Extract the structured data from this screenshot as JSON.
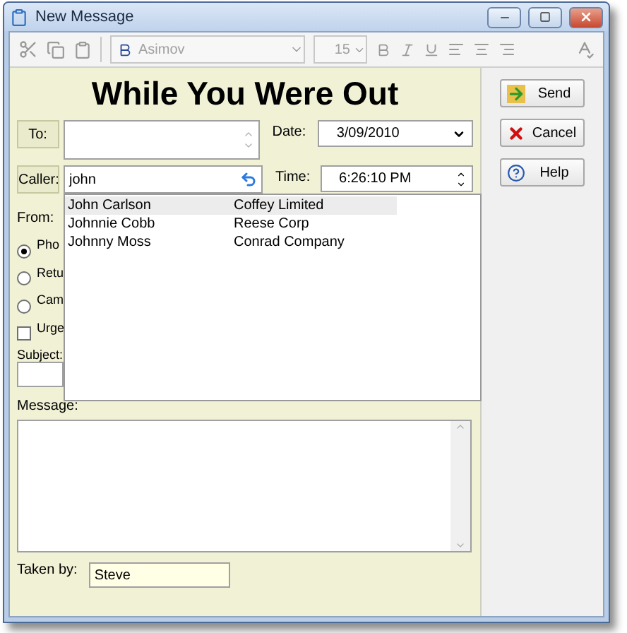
{
  "window": {
    "title": "New Message"
  },
  "toolbar": {
    "font": "Asimov",
    "size": "15"
  },
  "heading": "While You Were Out",
  "to": {
    "label": "To:"
  },
  "date": {
    "label": "Date:",
    "value": "3/09/2010"
  },
  "caller": {
    "label": "Caller:",
    "value": "john"
  },
  "time": {
    "label": "Time:",
    "value": "6:26:10 PM"
  },
  "suggestions": [
    {
      "name": "John Carlson",
      "company": "Coffey Limited",
      "selected": true
    },
    {
      "name": "Johnnie Cobb",
      "company": "Reese Corp",
      "selected": false
    },
    {
      "name": "Johnny Moss",
      "company": "Conrad Company",
      "selected": false
    }
  ],
  "from_label": "From:",
  "options": [
    {
      "kind": "radio",
      "label": "Pho",
      "checked": true
    },
    {
      "kind": "radio",
      "label": "Retu",
      "checked": false
    },
    {
      "kind": "radio",
      "label": "Cam",
      "checked": false
    },
    {
      "kind": "checkbox",
      "label": "Urge",
      "checked": false
    }
  ],
  "subject_label": "Subject:",
  "message_label": "Message:",
  "taken_by": {
    "label": "Taken by:",
    "value": "Steve"
  },
  "buttons": [
    {
      "kind": "send",
      "label": "Send"
    },
    {
      "kind": "cancel",
      "label": "Cancel"
    },
    {
      "kind": "help",
      "label": "Help"
    }
  ]
}
